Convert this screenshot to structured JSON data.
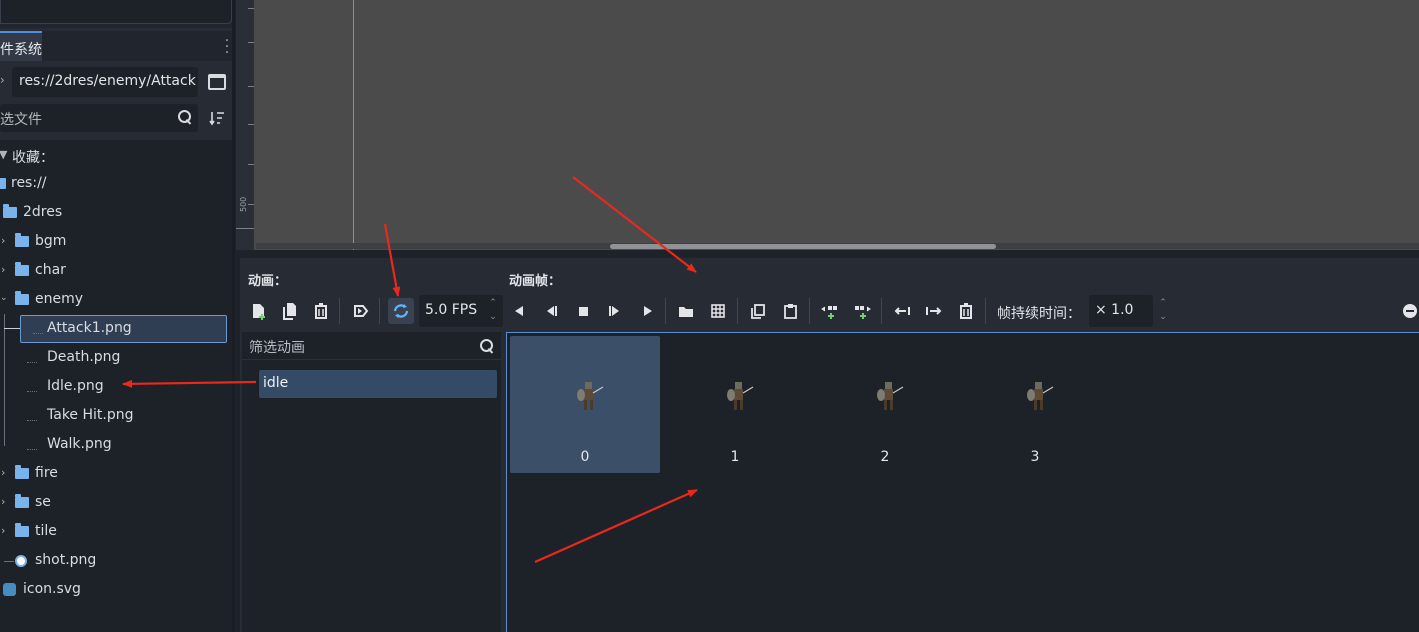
{
  "filesystem": {
    "tab_label": "文件系统",
    "path": "res://2dres/enemy/Attack",
    "filter_placeholder": "筛选文件",
    "tree": {
      "favorites": "收藏：",
      "root": "res://",
      "folder_2dres": "2dres",
      "folder_bgm": "bgm",
      "folder_char": "char",
      "folder_enemy": "enemy",
      "file_attack1": "Attack1.png",
      "file_death": "Death.png",
      "file_idle": "Idle.png",
      "file_takehit": "Take Hit.png",
      "file_walk": "Walk.png",
      "folder_fire": "fire",
      "folder_se": "se",
      "folder_tile": "tile",
      "file_shot": "shot.png",
      "file_icon": "icon.svg"
    }
  },
  "viewport": {
    "ruler_label": "500"
  },
  "spriteframes": {
    "animations_header": "动画：",
    "frames_header": "动画帧：",
    "fps_value": "5.0 FPS",
    "frame_duration_label": "帧持续时间：",
    "frame_duration_value": "× 1.0",
    "anim_filter_placeholder": "筛选动画",
    "animations": [
      "idle"
    ],
    "frames": [
      "0",
      "1",
      "2",
      "3"
    ],
    "selected_frame": 0,
    "toolbar_icons": [
      "new-animation-icon",
      "duplicate-animation-icon",
      "delete-animation-icon",
      "autoplay-icon",
      "loop-icon",
      "play-backwards-from-end-icon",
      "play-backwards-icon",
      "stop-icon",
      "play-icon",
      "play-from-start-icon",
      "load-frames-icon",
      "load-spritesheet-icon",
      "copy-frame-icon",
      "paste-frame-icon",
      "insert-before-icon",
      "insert-after-icon",
      "move-left-icon",
      "move-right-icon",
      "delete-frame-icon",
      "zoom-out-icon"
    ]
  },
  "colors": {
    "accent": "#4f8de0",
    "annotation": "#e8291c",
    "folder": "#7ab2ec",
    "selection": "#3b4f69"
  }
}
